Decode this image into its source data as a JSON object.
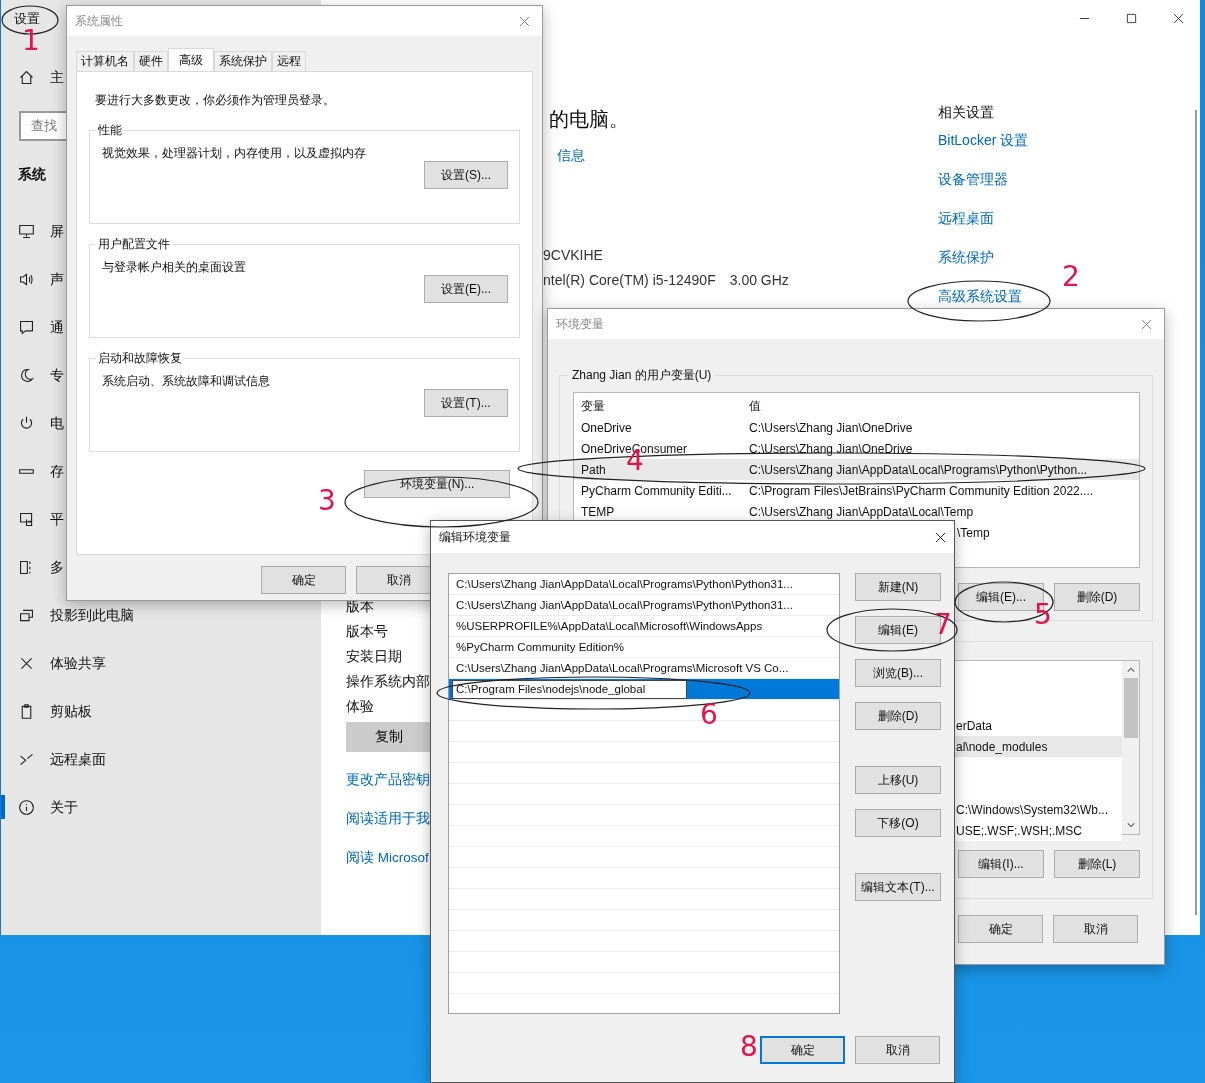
{
  "settings_window": {
    "title": "设置",
    "home": "主",
    "search": {
      "placeholder": "查找"
    },
    "section": "系统",
    "sidebar_items": [
      {
        "label": "屏",
        "selected": false
      },
      {
        "label": "声",
        "selected": false
      },
      {
        "label": "通",
        "selected": false
      },
      {
        "label": "专",
        "selected": false
      },
      {
        "label": "电",
        "selected": false
      },
      {
        "label": "存",
        "selected": false
      },
      {
        "label": "平",
        "selected": false
      },
      {
        "label": "多",
        "selected": false
      },
      {
        "label": "投影到此电脑",
        "selected": false
      },
      {
        "label": "体验共享",
        "selected": false
      },
      {
        "label": "剪贴板",
        "selected": false
      },
      {
        "label": "远程桌面",
        "selected": false
      },
      {
        "label": "关于",
        "selected": true
      }
    ],
    "heading": "的电脑。",
    "details_link": "信息",
    "device_id": "9CVKIHE",
    "processor": "ntel(R) Core(TM) i5-12490F",
    "processor_speed": "3.00 GHz",
    "spec_labels": [
      "版本",
      "版本号",
      "安装日期",
      "操作系统内部",
      "体验"
    ],
    "copy_button": "复制",
    "links": [
      "更改产品密钥",
      "阅读适用于我",
      "阅读 Microsof"
    ],
    "related_title": "相关设置",
    "related_links": [
      "BitLocker 设置",
      "设备管理器",
      "远程桌面",
      "系统保护",
      "高级系统设置"
    ]
  },
  "system_properties": {
    "title": "系统属性",
    "tabs": [
      {
        "label": "计算机名",
        "selected": false
      },
      {
        "label": "硬件",
        "selected": false
      },
      {
        "label": "高级",
        "selected": true
      },
      {
        "label": "系统保护",
        "selected": false
      },
      {
        "label": "远程",
        "selected": false
      }
    ],
    "notice": "要进行大多数更改，你必须作为管理员登录。",
    "groups": [
      {
        "title": "性能",
        "description": "视觉效果，处理器计划，内存使用，以及虚拟内存",
        "button": "设置(S)..."
      },
      {
        "title": "用户配置文件",
        "description": "与登录帐户相关的桌面设置",
        "button": "设置(E)..."
      },
      {
        "title": "启动和故障恢复",
        "description": "系统启动、系统故障和调试信息",
        "button": "设置(T)..."
      }
    ],
    "env_button": "环境变量(N)...",
    "buttons": [
      "确定",
      "取消"
    ]
  },
  "environment_variables": {
    "title": "环境变量",
    "user_group": "Zhang Jian 的用户变量(U)",
    "columns": [
      "变量",
      "值"
    ],
    "rows": [
      {
        "kind": "full",
        "name": "OneDrive",
        "value": "C:\\Users\\Zhang Jian\\OneDrive",
        "selected": false
      },
      {
        "kind": "full",
        "name": "OneDriveConsumer",
        "value": "C:\\Users\\Zhang Jian\\OneDrive",
        "selected": false
      },
      {
        "kind": "full",
        "name": "Path",
        "value": "C:\\Users\\Zhang Jian\\AppData\\Local\\Programs\\Python\\Python...",
        "selected": true
      },
      {
        "kind": "full",
        "name": "PyCharm Community Editi...",
        "value": "C:\\Program Files\\JetBrains\\PyCharm Community Edition 2022....",
        "selected": false
      },
      {
        "kind": "full",
        "name": "TEMP",
        "value": "C:\\Users\\Zhang Jian\\AppData\\Local\\Temp",
        "selected": false
      },
      {
        "kind": "partial",
        "value": "\\Temp",
        "selected": false
      }
    ],
    "user_buttons": [
      "编辑(E)...",
      "删除(D)"
    ],
    "system_rows": [
      {
        "value": "erData",
        "selected": false
      },
      {
        "value": "al\\node_modules",
        "selected": true
      },
      {
        "value": "C:\\Windows\\System32\\Wb...",
        "selected": false
      },
      {
        "value": "USE;.WSF;.WSH;.MSC",
        "selected": false
      }
    ],
    "system_buttons": [
      "编辑(I)...",
      "删除(L)"
    ],
    "buttons": [
      "确定",
      "取消"
    ]
  },
  "edit_variable": {
    "title": "编辑环境变量",
    "entries": [
      {
        "value": "C:\\Users\\Zhang Jian\\AppData\\Local\\Programs\\Python\\Python31...",
        "selected": false,
        "editing": false
      },
      {
        "value": "C:\\Users\\Zhang Jian\\AppData\\Local\\Programs\\Python\\Python31...",
        "selected": false,
        "editing": false
      },
      {
        "value": "%USERPROFILE%\\AppData\\Local\\Microsoft\\WindowsApps",
        "selected": false,
        "editing": false
      },
      {
        "value": "%PyCharm Community Edition%",
        "selected": false,
        "editing": false
      },
      {
        "value": "C:\\Users\\Zhang Jian\\AppData\\Local\\Programs\\Microsoft VS Co...",
        "selected": false,
        "editing": false
      },
      {
        "value": "C:\\Program Files\\nodejs\\node_global",
        "selected": true,
        "editing": true
      }
    ],
    "side_buttons": [
      "新建(N)",
      "编辑(E)",
      "浏览(B)...",
      "删除(D)",
      "上移(U)",
      "下移(O)",
      "编辑文本(T)..."
    ],
    "buttons": [
      {
        "label": "确定",
        "default": true
      },
      {
        "label": "取消",
        "default": false
      }
    ]
  },
  "annotations": [
    {
      "number": "1",
      "circled": true
    },
    {
      "number": "2",
      "circled": true
    },
    {
      "number": "3",
      "circled": true
    },
    {
      "number": "4",
      "circled": true
    },
    {
      "number": "5",
      "circled": true
    },
    {
      "number": "6",
      "circled": true
    },
    {
      "number": "7",
      "circled": true
    },
    {
      "number": "8",
      "circled": false
    }
  ]
}
